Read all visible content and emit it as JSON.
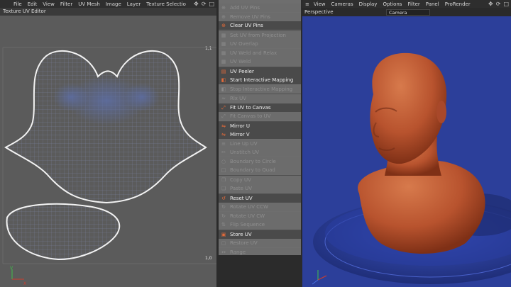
{
  "left_menu": {
    "items": [
      "File",
      "Edit",
      "View",
      "Filter",
      "UV Mesh",
      "Image",
      "Layer",
      "Texture Selectio"
    ]
  },
  "right_menu": {
    "items": [
      "View",
      "Cameras",
      "Display",
      "Options",
      "Filter",
      "Panel",
      "ProRender"
    ]
  },
  "uv_editor": {
    "title": "Texture UV Editor",
    "corner_top": "1,1",
    "corner_bottom": "1,0"
  },
  "commands": [
    {
      "label": "Add UV Pins",
      "enabled": false,
      "icon": "pin-icon"
    },
    {
      "label": "Remove UV Pins",
      "enabled": false,
      "icon": "pin-icon"
    },
    {
      "label": "Clear UV Pins",
      "enabled": true,
      "icon": "pin-icon"
    },
    {
      "label": "Set UV from Projection",
      "enabled": false,
      "icon": "grid-icon"
    },
    {
      "label": "UV Overlap",
      "enabled": false,
      "icon": "grid-icon"
    },
    {
      "label": "UV Weld and Relax",
      "enabled": false,
      "icon": "grid-icon"
    },
    {
      "label": "UV Weld",
      "enabled": false,
      "icon": "grid-icon"
    },
    {
      "label": "UV Peeler",
      "enabled": true,
      "icon": "peeler-icon"
    },
    {
      "label": "Start Interactive Mapping",
      "enabled": true,
      "icon": "mapping-icon"
    },
    {
      "label": "Stop Interactive Mapping",
      "enabled": false,
      "icon": "mapping-icon"
    },
    {
      "label": "Rlx UV",
      "enabled": false,
      "icon": "relax-icon"
    },
    {
      "label": "Fit UV to Canvas",
      "enabled": true,
      "icon": "fit-icon"
    },
    {
      "label": "Fit Canvas to UV",
      "enabled": false,
      "icon": "fit-icon"
    },
    {
      "label": "Mirror U",
      "enabled": true,
      "icon": "mirror-icon"
    },
    {
      "label": "Mirror V",
      "enabled": true,
      "icon": "mirror-icon"
    },
    {
      "label": "Line Up UV",
      "enabled": false,
      "icon": "lineup-icon"
    },
    {
      "label": "Unstitch UV",
      "enabled": false,
      "icon": "stitch-icon"
    },
    {
      "label": "Boundary to Circle",
      "enabled": false,
      "icon": "circle-icon"
    },
    {
      "label": "Boundary to Quad",
      "enabled": false,
      "icon": "quad-icon"
    },
    {
      "label": "Copy UV",
      "enabled": false,
      "icon": "copy-icon"
    },
    {
      "label": "Paste UV",
      "enabled": false,
      "icon": "paste-icon"
    },
    {
      "label": "Reset UV",
      "enabled": true,
      "icon": "reset-icon"
    },
    {
      "label": "Rotate UV CCW",
      "enabled": false,
      "icon": "rotate-icon"
    },
    {
      "label": "Rotate UV CW",
      "enabled": false,
      "icon": "rotate-icon"
    },
    {
      "label": "Flip Sequence",
      "enabled": false,
      "icon": "flip-icon"
    },
    {
      "label": "Store UV",
      "enabled": true,
      "icon": "store-icon"
    },
    {
      "label": "Restore UV",
      "enabled": false,
      "icon": "restore-icon"
    },
    {
      "label": "Range",
      "enabled": false,
      "icon": "range-icon"
    }
  ],
  "viewport": {
    "mode": "Perspective",
    "camera": "Camera"
  },
  "colors": {
    "uv_background": "#5b5b5b",
    "uv_wire": "#6d7592",
    "uv_outline": "#f2f2f2",
    "viewport_background": "#2c3f9a",
    "bust": "#b8532e",
    "accent": "#e06a3a"
  }
}
